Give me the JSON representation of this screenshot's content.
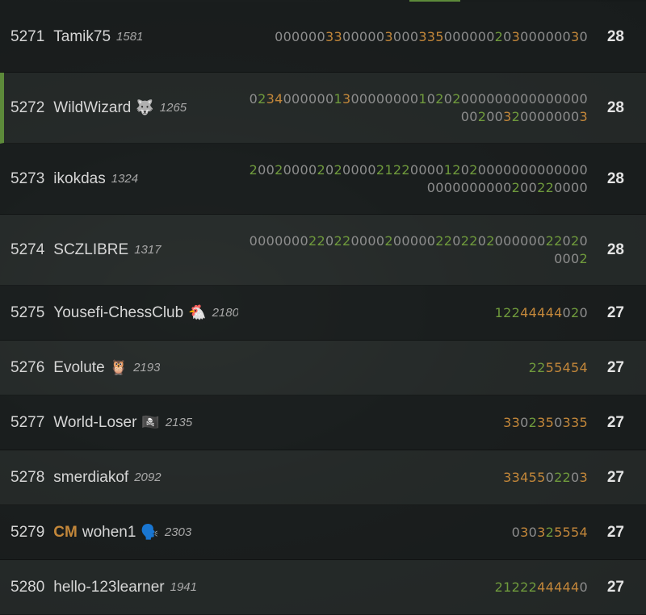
{
  "colors": {
    "win_digit": "#6f9a3c",
    "streak_digit": "#c3873a",
    "zero_digit": "#8d8d8d",
    "me_marker": "#5d8a3a"
  },
  "players": [
    {
      "rank": "5271",
      "title": "",
      "name": "Tamik75",
      "flair": "",
      "flair_icon": "",
      "rating": "1581",
      "sheet": "000000330000030003350000002030000003",
      "sheet_wrap": "0",
      "score": "28"
    },
    {
      "rank": "5272",
      "title": "",
      "name": "WildWizard",
      "flair": "🐺",
      "flair_icon": "wolf-icon",
      "rating": "1265",
      "sheet": "0234000000130000000010202000000000000",
      "sheet_wrap": "000002003200000003",
      "score": "28"
    },
    {
      "rank": "5273",
      "title": "",
      "name": "ikokdas",
      "flair": "",
      "flair_icon": "",
      "rating": "1324",
      "sheet": "200200002020000212200001202000000000000",
      "sheet_wrap": "00000000000200220000",
      "score": "28"
    },
    {
      "rank": "5274",
      "title": "",
      "name": "SCZLIBRE",
      "flair": "",
      "flair_icon": "",
      "rating": "1317",
      "sheet": "0000000220220000200000220220200000022",
      "sheet_wrap": "0200002",
      "score": "28"
    },
    {
      "rank": "5275",
      "title": "",
      "name": "Yousefi-ChessClub",
      "flair": "🐔",
      "flair_icon": "chicken-icon",
      "rating": "2180",
      "sheet": "12244444020",
      "sheet_wrap": "",
      "score": "27"
    },
    {
      "rank": "5276",
      "title": "",
      "name": "Evolute",
      "flair": "🦉",
      "flair_icon": "owl-icon",
      "rating": "2193",
      "sheet": "2255454",
      "sheet_wrap": "",
      "score": "27"
    },
    {
      "rank": "5277",
      "title": "",
      "name": "World-Loser",
      "flair": "🏴‍☠️",
      "flair_icon": "pirate-flag-icon",
      "rating": "2135",
      "sheet": "3302350335",
      "sheet_wrap": "",
      "score": "27"
    },
    {
      "rank": "5278",
      "title": "",
      "name": "smerdiakof",
      "flair": "",
      "flair_icon": "",
      "rating": "2092",
      "sheet": "3345502203",
      "sheet_wrap": "",
      "score": "27"
    },
    {
      "rank": "5279",
      "title": "CM",
      "name": "wohen1",
      "flair": "🗣️",
      "flair_icon": "speaking-head-icon",
      "rating": "2303",
      "sheet": "030325554",
      "sheet_wrap": "",
      "score": "27"
    },
    {
      "rank": "5280",
      "title": "",
      "name": "hello-123learner",
      "flair": "",
      "flair_icon": "",
      "rating": "1941",
      "sheet": "21222444440",
      "sheet_wrap": "",
      "score": "27"
    }
  ]
}
